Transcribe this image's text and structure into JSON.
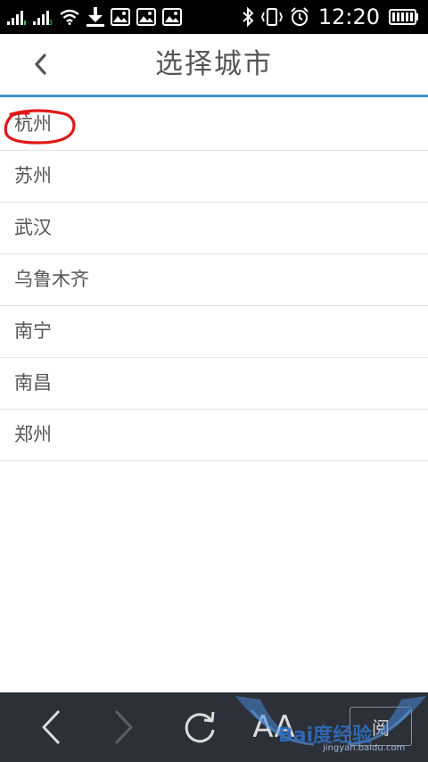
{
  "status_bar": {
    "time": "12:20",
    "icons": [
      "signal-1-icon",
      "signal-2-icon",
      "wifi-icon",
      "download-icon",
      "image-icon",
      "image-icon",
      "image-icon",
      "bluetooth-icon",
      "vibrate-icon",
      "alarm-icon",
      "battery-icon"
    ]
  },
  "header": {
    "back_icon": "chevron-left-icon",
    "title": "选择城市",
    "accent_color": "#3a97c9"
  },
  "cities": [
    {
      "label": "杭州",
      "highlighted": true
    },
    {
      "label": "苏州"
    },
    {
      "label": "武汉"
    },
    {
      "label": "乌鲁木齐"
    },
    {
      "label": "南宁"
    },
    {
      "label": "南昌"
    },
    {
      "label": "郑州"
    }
  ],
  "toolbar": {
    "back_icon": "chevron-left-icon",
    "forward_icon": "chevron-right-icon",
    "refresh_icon": "refresh-icon",
    "font_label": "AA",
    "reader_label": "阅"
  },
  "watermark": {
    "text": "Bai度经验",
    "sub": "jingyan.baidu.com"
  }
}
